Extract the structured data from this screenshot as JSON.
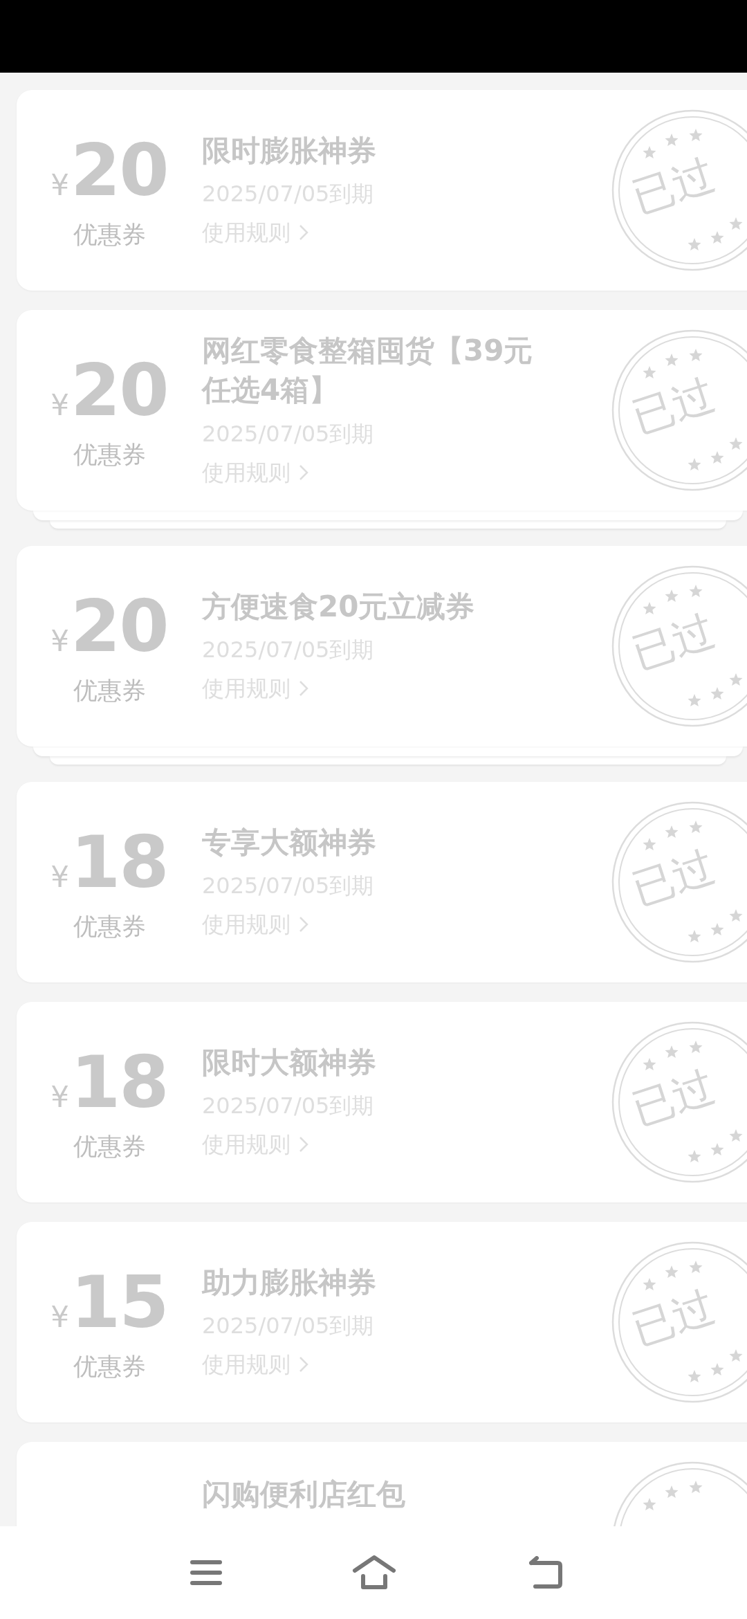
{
  "coupons": [
    {
      "currency": "¥",
      "amount": "20",
      "label": "优惠券",
      "title": "限时膨胀神券",
      "expiry": "2025/07/05到期",
      "rule": "使用规则",
      "stacked": false,
      "stamp": "已过"
    },
    {
      "currency": "¥",
      "amount": "20",
      "label": "优惠券",
      "title": "网红零食整箱囤货【39元任选4箱】",
      "expiry": "2025/07/05到期",
      "rule": "使用规则",
      "stacked": true,
      "stamp": "已过"
    },
    {
      "currency": "¥",
      "amount": "20",
      "label": "优惠券",
      "title": "方便速食20元立减券",
      "expiry": "2025/07/05到期",
      "rule": "使用规则",
      "stacked": true,
      "stamp": "已过"
    },
    {
      "currency": "¥",
      "amount": "18",
      "label": "优惠券",
      "title": "专享大额神券",
      "expiry": "2025/07/05到期",
      "rule": "使用规则",
      "stacked": false,
      "stamp": "已过"
    },
    {
      "currency": "¥",
      "amount": "18",
      "label": "优惠券",
      "title": "限时大额神券",
      "expiry": "2025/07/05到期",
      "rule": "使用规则",
      "stacked": false,
      "stamp": "已过"
    },
    {
      "currency": "¥",
      "amount": "15",
      "label": "优惠券",
      "title": "助力膨胀神券",
      "expiry": "2025/07/05到期",
      "rule": "使用规则",
      "stacked": false,
      "stamp": "已过"
    },
    {
      "title": "闪购便利店红包",
      "stacked": false
    }
  ]
}
